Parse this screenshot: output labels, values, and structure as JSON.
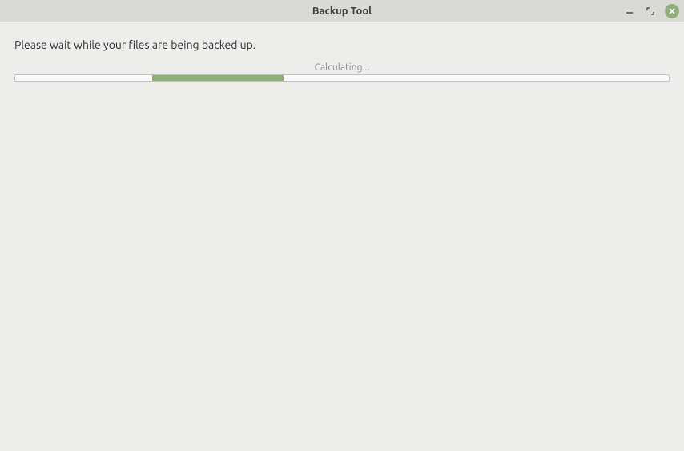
{
  "window": {
    "title": "Backup Tool"
  },
  "main": {
    "message": "Please wait while your files are being backed up.",
    "status": "Calculating..."
  },
  "progress": {
    "indeterminate": true,
    "chunk_left_pct": 21,
    "chunk_width_pct": 20
  },
  "colors": {
    "accent": "#8fb07a",
    "background": "#ededeb",
    "titlebar": "#d9d9d6"
  }
}
